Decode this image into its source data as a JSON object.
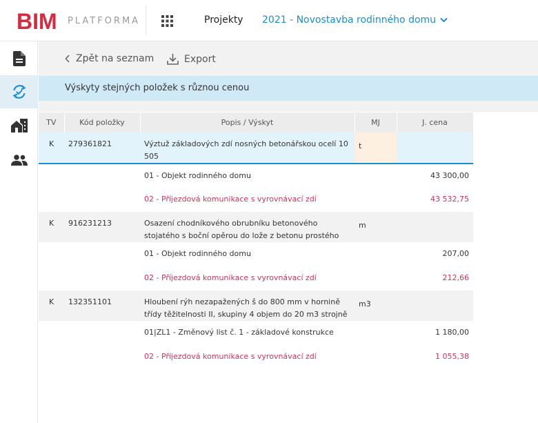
{
  "header": {
    "logo_text": "BIM",
    "platform_label": "PLATFORMA",
    "projekty_label": "Projekty",
    "project_name": "2021 - Novostavba rodinného domu",
    "brand_color": "#d62b3f",
    "accent_color": "#1a8ed0"
  },
  "sidebar": {
    "items": [
      {
        "icon": "document-icon",
        "active": false
      },
      {
        "icon": "sync-icon",
        "active": true
      },
      {
        "icon": "buildings-icon",
        "active": false
      },
      {
        "icon": "users-icon",
        "active": false
      }
    ]
  },
  "toolbar": {
    "back_label": "Zpět na seznam",
    "export_label": "Export"
  },
  "banner": {
    "text": "Výskyty stejných položek s různou cenou"
  },
  "table": {
    "headers": {
      "tv": "TV",
      "kod": "Kód položky",
      "popis": "Popis / Výskyt",
      "mj": "MJ",
      "cena": "J. cena"
    },
    "rows": [
      {
        "tv": "K",
        "kod": "279361821",
        "popis": "Výztuž základových zdí nosných betonářskou ocelí 10 505",
        "mj": "t",
        "occurrences": [
          {
            "popis": "01 - Objekt rodinného domu",
            "cena": "43 300,00",
            "diff": false
          },
          {
            "popis": "02 - Příjezdová komunikace s vyrovnávací zdí",
            "cena": "43 532,75",
            "diff": true
          }
        ]
      },
      {
        "tv": "K",
        "kod": "916231213",
        "popis": "Osazení chodníkového obrubníku betonového stojatého s boční opěrou do lože z betonu prostého",
        "mj": "m",
        "occurrences": [
          {
            "popis": "01 - Objekt rodinného domu",
            "cena": "207,00",
            "diff": false
          },
          {
            "popis": "02 - Příjezdová komunikace s vyrovnávací zdí",
            "cena": "212,66",
            "diff": true
          }
        ]
      },
      {
        "tv": "K",
        "kod": "132351101",
        "popis": "Hloubení rýh nezapažených š do 800 mm v hornině třídy těžitelnosti II, skupiny 4 objem do 20 m3 strojně",
        "mj": "m3",
        "occurrences": [
          {
            "popis": "01|ZL1 - Změnový list č. 1 - základové konstrukce",
            "cena": "1 180,00",
            "diff": false
          },
          {
            "popis": "02 - Příjezdová komunikace s vyrovnávací zdí",
            "cena": "1 055,38",
            "diff": true
          }
        ]
      }
    ]
  }
}
